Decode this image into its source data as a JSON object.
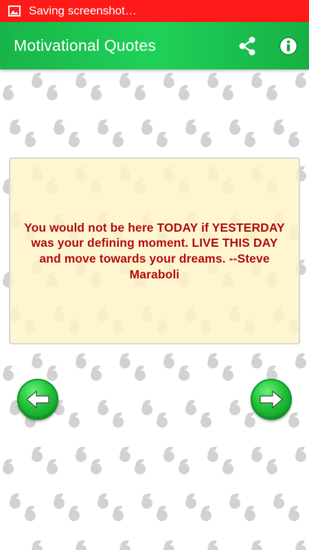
{
  "status_bar": {
    "text": "Saving screenshot…",
    "icon": "image-icon",
    "color": "#ff1a1a"
  },
  "app_bar": {
    "title": "Motivational Quotes",
    "share_icon": "share-icon",
    "info_icon": "info-icon",
    "color": "#1fc452"
  },
  "quote": {
    "text": "You would not be here TODAY if YESTERDAY was your defining moment. LIVE THIS DAY and move towards your dreams. --Steve Maraboli",
    "text_color": "#b30d0d",
    "card_color": "#fff4c8"
  },
  "navigation": {
    "prev_icon": "arrow-left-icon",
    "next_icon": "arrow-right-icon",
    "button_color": "#22c23a"
  },
  "background": {
    "pattern_icon": "quote-mark-icon",
    "pattern_color": "#d2d2d2"
  }
}
